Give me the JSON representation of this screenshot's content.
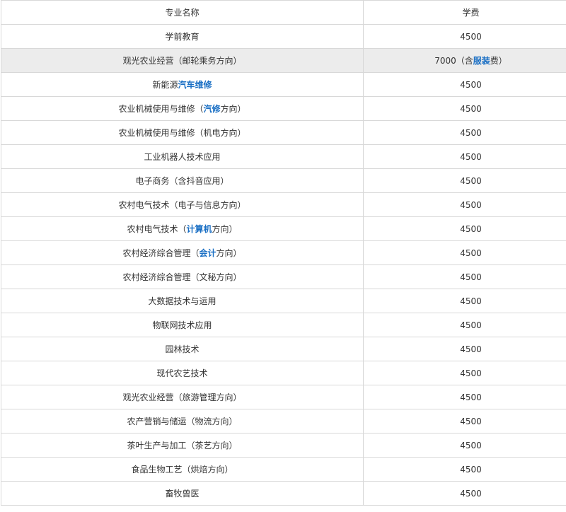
{
  "table": {
    "header": {
      "name": "专业名称",
      "fee": "学费"
    },
    "rows": [
      {
        "name": [
          "学前教育"
        ],
        "fee": [
          "4500"
        ]
      },
      {
        "name": [
          "观光农业经营（邮轮乘务方向）"
        ],
        "fee": [
          "7000（含",
          "服装",
          "费）"
        ],
        "highlight": true
      },
      {
        "name": [
          "新能源",
          "汽车维修"
        ],
        "fee": [
          "4500"
        ]
      },
      {
        "name": [
          "农业机械使用与维修（",
          "汽修",
          "方向）"
        ],
        "fee": [
          "4500"
        ]
      },
      {
        "name": [
          "农业机械使用与维修（机电方向）"
        ],
        "fee": [
          "4500"
        ]
      },
      {
        "name": [
          "工业机器人技术应用"
        ],
        "fee": [
          "4500"
        ]
      },
      {
        "name": [
          "电子商务（含抖音应用）"
        ],
        "fee": [
          "4500"
        ]
      },
      {
        "name": [
          "农村电气技术（电子与信息方向）"
        ],
        "fee": [
          "4500"
        ]
      },
      {
        "name": [
          "农村电气技术（",
          "计算机",
          "方向）"
        ],
        "fee": [
          "4500"
        ]
      },
      {
        "name": [
          "农村经济综合管理（",
          "会计",
          "方向）"
        ],
        "fee": [
          "4500"
        ]
      },
      {
        "name": [
          "农村经济综合管理（文秘方向）"
        ],
        "fee": [
          "4500"
        ]
      },
      {
        "name": [
          "大数据技术与运用"
        ],
        "fee": [
          "4500"
        ]
      },
      {
        "name": [
          "物联网技术应用"
        ],
        "fee": [
          "4500"
        ]
      },
      {
        "name": [
          "园林技术"
        ],
        "fee": [
          "4500"
        ]
      },
      {
        "name": [
          "现代农艺技术"
        ],
        "fee": [
          "4500"
        ]
      },
      {
        "name": [
          "观光农业经营（旅游管理方向）"
        ],
        "fee": [
          "4500"
        ]
      },
      {
        "name": [
          "农产营销与储运（物流方向）"
        ],
        "fee": [
          "4500"
        ]
      },
      {
        "name": [
          "茶叶生产与加工（茶艺方向）"
        ],
        "fee": [
          "4500"
        ]
      },
      {
        "name": [
          "食品生物工艺（烘焙方向）"
        ],
        "fee": [
          "4500"
        ]
      },
      {
        "name": [
          "畜牧兽医"
        ],
        "fee": [
          "4500"
        ]
      }
    ]
  },
  "colors": {
    "link": "#1a6fc4",
    "highlight_row": "#ececec",
    "border": "#d8d8d8"
  }
}
